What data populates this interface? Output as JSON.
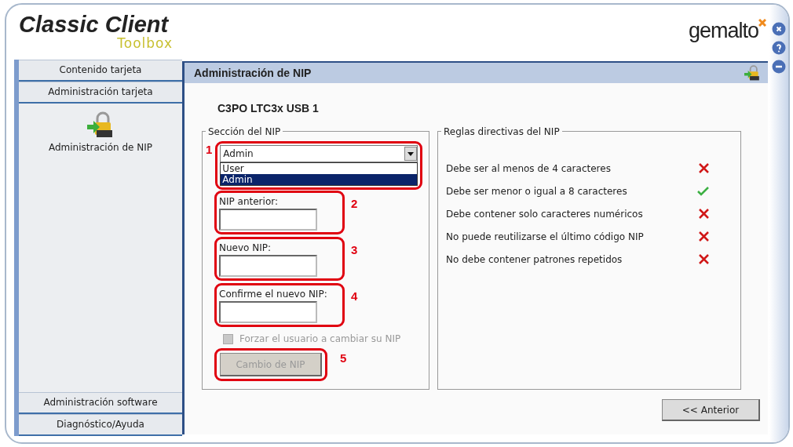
{
  "logo": {
    "title": "Classic Client",
    "subtitle": "Toolbox"
  },
  "brand": "gemalto",
  "window_buttons": [
    {
      "kind": "close"
    },
    {
      "kind": "help"
    },
    {
      "kind": "minimize"
    }
  ],
  "sidebar": {
    "items": [
      {
        "label": "Contenido tarjeta"
      },
      {
        "label": "Administración tarjeta",
        "children": [
          {
            "label": "Administración de NIP"
          }
        ]
      }
    ],
    "bottom_items": [
      {
        "label": "Administración software"
      },
      {
        "label": "Diagnóstico/Ayuda"
      }
    ]
  },
  "panel": {
    "title": "Administración de NIP",
    "device": "C3PO LTC3x USB 1",
    "pin_section": {
      "legend": "Sección del NIP",
      "dropdown": {
        "marker": "1",
        "value": "Admin",
        "open": true,
        "options": [
          {
            "label": "User",
            "selected": false
          },
          {
            "label": "Admin",
            "selected": true
          }
        ]
      },
      "fields": [
        {
          "label": "NIP anterior:",
          "marker": "2"
        },
        {
          "label": "Nuevo NIP:",
          "marker": "3"
        },
        {
          "label": "Confirme el nuevo NIP:",
          "marker": "4"
        }
      ],
      "checkbox": {
        "label": "Forzar el usuario a cambiar su NIP",
        "checked": false,
        "disabled": true
      },
      "button": {
        "label": "Cambio de NIP",
        "disabled": true,
        "marker": "5"
      }
    },
    "rules_section": {
      "legend": "Reglas directivas del NIP",
      "rules": [
        {
          "text": "Debe ser al menos de 4 caracteres",
          "passed": false
        },
        {
          "text": "Debe ser menor o igual a 8 caracteres",
          "passed": true
        },
        {
          "text": "Debe contener solo caracteres numéricos",
          "passed": false
        },
        {
          "text": "No puede reutilizarse el último código NIP",
          "passed": false
        },
        {
          "text": "No debe contener patrones repetidos",
          "passed": false
        }
      ]
    },
    "back_button": "<< Anterior"
  }
}
